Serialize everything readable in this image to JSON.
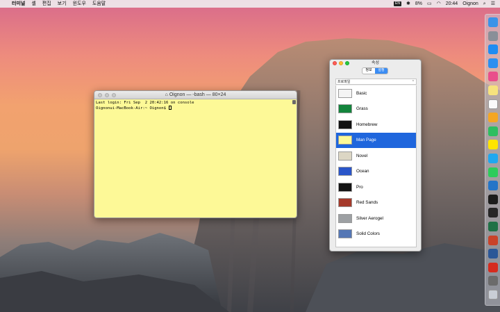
{
  "menubar": {
    "apple": "",
    "app_name": "터미널",
    "menus": [
      "셸",
      "편집",
      "보기",
      "윈도우",
      "도움말"
    ],
    "status": {
      "input_badge": "EN",
      "battery": "8%",
      "time": "20:44",
      "user": "Oignon"
    }
  },
  "terminal": {
    "title": "Oignon — -bash — 80×24",
    "lines": [
      "Last login: Fri Sep  2 20:42:16 on console",
      "Oignonui-MacBook-Air:~ Oignon$ "
    ],
    "background_color": "#fdf997"
  },
  "inspector": {
    "title": "속성",
    "tabs": [
      {
        "label": "정보",
        "active": false
      },
      {
        "label": "설정",
        "active": true
      }
    ],
    "profile_label": "프로파일",
    "profiles": [
      {
        "name": "Basic",
        "swatch": "#f4f4f4",
        "selected": false
      },
      {
        "name": "Grass",
        "swatch": "#13843c",
        "selected": false
      },
      {
        "name": "Homebrew",
        "swatch": "#121212",
        "selected": false
      },
      {
        "name": "Man Page",
        "swatch": "#fdf997",
        "selected": true
      },
      {
        "name": "Novel",
        "swatch": "#dcd6c4",
        "selected": false
      },
      {
        "name": "Ocean",
        "swatch": "#2a55c9",
        "selected": false
      },
      {
        "name": "Pro",
        "swatch": "#141414",
        "selected": false
      },
      {
        "name": "Red Sands",
        "swatch": "#a53a2b",
        "selected": false
      },
      {
        "name": "Silver Aerogel",
        "swatch": "#9da0a3",
        "selected": false
      },
      {
        "name": "Solid Colors",
        "swatch": "#5577b5",
        "selected": false
      }
    ]
  },
  "dock": {
    "apps": [
      {
        "icon": "finder-icon",
        "color": "#3b93e8"
      },
      {
        "icon": "launchpad-icon",
        "color": "#8a8f98"
      },
      {
        "icon": "app-store-icon",
        "color": "#1f8cf2"
      },
      {
        "icon": "safari-icon",
        "color": "#2b8ff0"
      },
      {
        "icon": "itunes-icon",
        "color": "#e94f8b"
      },
      {
        "icon": "notes-icon",
        "color": "#f6e27d"
      },
      {
        "icon": "calendar-icon",
        "color": "#fafafa"
      },
      {
        "icon": "photos-icon",
        "color": "#f5a623"
      },
      {
        "icon": "evernote-icon",
        "color": "#2dbe60"
      },
      {
        "icon": "kakaotalk-icon",
        "color": "#ffe400"
      },
      {
        "icon": "messages-icon",
        "color": "#1ea8f0"
      },
      {
        "icon": "facetime-icon",
        "color": "#2dcc5b"
      },
      {
        "icon": "xcode-icon",
        "color": "#2475c8"
      },
      {
        "icon": "terminal-icon",
        "color": "#1c1c1c"
      },
      {
        "icon": "activity-monitor-icon",
        "color": "#262626"
      },
      {
        "icon": "excel-icon",
        "color": "#1f7145"
      },
      {
        "icon": "powerpoint-icon",
        "color": "#c9432a"
      },
      {
        "icon": "word-icon",
        "color": "#2b5797"
      },
      {
        "icon": "pdf-icon",
        "color": "#d52b1e"
      },
      {
        "icon": "disk-utility-icon",
        "color": "#6b6b6b"
      },
      {
        "icon": "trash-icon",
        "color": "#c9ced6"
      }
    ]
  }
}
